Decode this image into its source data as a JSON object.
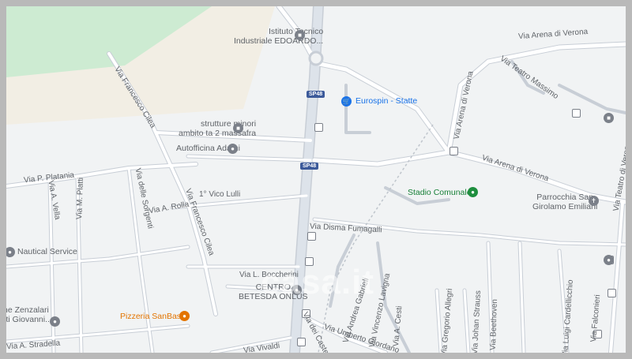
{
  "colors": {
    "background": "#f1f3f4",
    "park": "#cdebd2",
    "sand": "#f2eee4",
    "road": "#ffffff",
    "road_outline": "#c8ced6",
    "main_road": "#dde3ea",
    "shield": "#3c5a9a",
    "poi_blue": "#1a73e8",
    "poi_green": "#1e8e3e",
    "poi_orange": "#e37400",
    "poi_gray": "#7b8089"
  },
  "pois": {
    "istituto": {
      "line1": "Istituto Tecnico",
      "line2": "Industriale EDOARDO...",
      "icon": "school-icon"
    },
    "eurospin": {
      "label": "Eurospin - Statte",
      "icon": "shopping-cart-icon"
    },
    "strutture": {
      "line1": "strutture minori",
      "line2": "ambito ta 2 massafra",
      "icon": "school-icon"
    },
    "autofficina": {
      "label": "Autofficina Adami",
      "icon": "generic-place-icon"
    },
    "stadio": {
      "label": "Stadio Comunale",
      "icon": "stadium-icon"
    },
    "parrocchia": {
      "line1": "Parrocchia San",
      "line2": "Girolamo Emiliani",
      "icon": "church-icon"
    },
    "nautical": {
      "label": "Nautical Service",
      "icon": "generic-place-icon"
    },
    "centro": {
      "line1": "CENTRO",
      "line2": "BETESDA ONLUS",
      "icon": "generic-place-icon"
    },
    "pizzeria": {
      "label": "Pizzeria SanBasil",
      "icon": "restaurant-icon"
    },
    "zenzalari": {
      "line1": "ne Zenzalari",
      "line2": "rti Giovanni...",
      "icon": "generic-place-icon"
    }
  },
  "shields": {
    "sp48_top": "SP48",
    "sp48_mid": "SP48"
  },
  "streets": {
    "arena_top": "Via Arena di Verona",
    "arena_mid": "Via Arena di Verona",
    "arena_vertical": "Via Arena di Verona",
    "teatro_massimo": "Via Teatro Massimo",
    "teatro_di_verona": "Via Teatro di Verona",
    "cilea_top": "Via Francesco Cilea",
    "cilea_mid": "Via Francesco Cilea",
    "platania": "Via P. Platania",
    "vella": "Via A. Vella",
    "platti": "Via M. Platti",
    "sorgenti": "Via delle Sorgenti",
    "rolla": "Via A. Rolla",
    "vico_lulli": "1° Vico Lulli",
    "fumagalli": "Via Disma Fumagalli",
    "boccherini": "Via L. Boccherini",
    "gabrieli": "Via Andrea Gabrieli",
    "lavigna": "Via Vincenzo Lavigna",
    "cesti": "Via A. Cesti",
    "allegri": "Via Gregorio Allegri",
    "strauss": "Via Johan Strauss",
    "beethoven": "Via Beethoven",
    "cardellicchio": "Via Luigi Cardellicchio",
    "falconieri": "Via Falconieri",
    "giordano": "Via Umberto Giordano",
    "vivaldi": "Via Vivaldi",
    "castelli": "Via dei Castelli",
    "stradella": "Via A. Stradella"
  },
  "watermark": "casa.it"
}
